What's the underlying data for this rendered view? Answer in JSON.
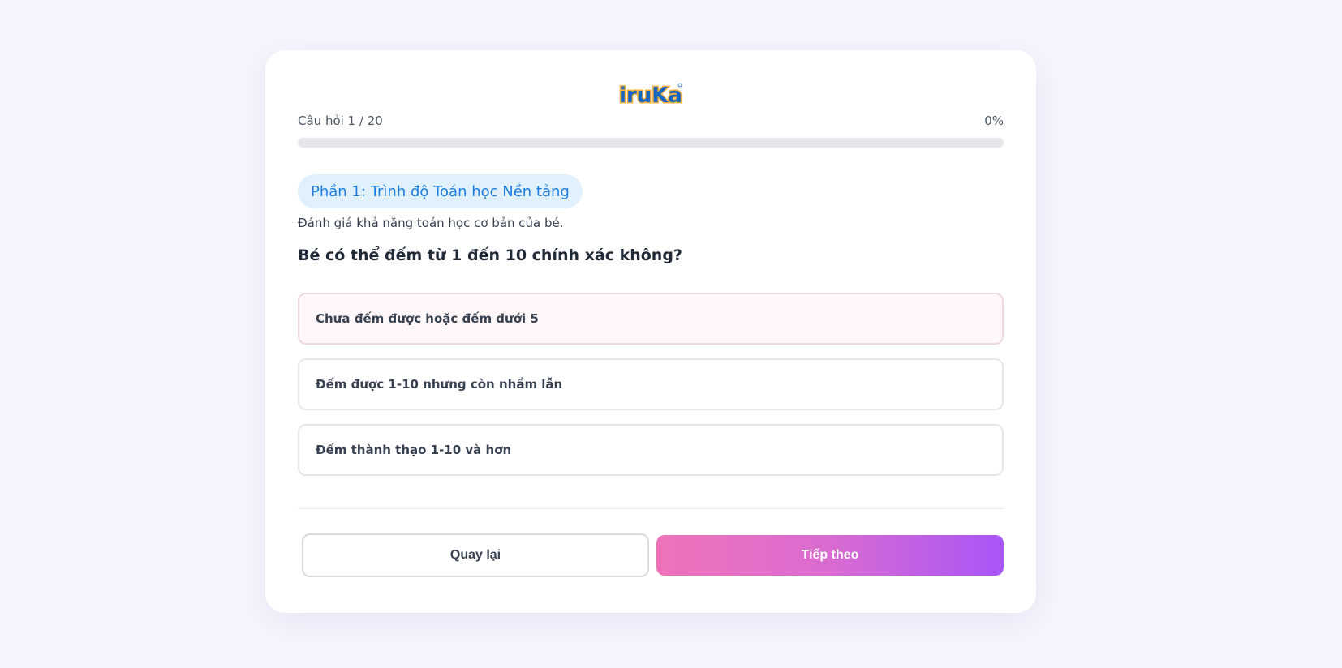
{
  "brand": {
    "logo_text": "iruKa",
    "logo_icon": "iruka-logo"
  },
  "progress": {
    "question_label": "Câu hỏi 1 / 20",
    "percent_label": "0%",
    "fraction": 0
  },
  "section": {
    "title": "Phần 1: Trình độ Toán học Nền tảng",
    "description": "Đánh giá khả năng toán học cơ bản của bé."
  },
  "question": {
    "text": "Bé có thể đếm từ 1 đến 10 chính xác không?",
    "options": [
      {
        "label": "Chưa đếm được hoặc đếm dưới 5"
      },
      {
        "label": "Đếm được 1-10 nhưng còn nhầm lẫn"
      },
      {
        "label": "Đếm thành thạo 1-10 và hơn"
      }
    ]
  },
  "buttons": {
    "back_label": "Quay lại",
    "next_label": "Tiếp theo"
  },
  "colors": {
    "page_background": "#f6f5fd",
    "accent_blue": "#1d7ee0",
    "pill_background": "#e0f1fd",
    "gradient_start": "#ef72b9",
    "gradient_end": "#a855f7"
  }
}
